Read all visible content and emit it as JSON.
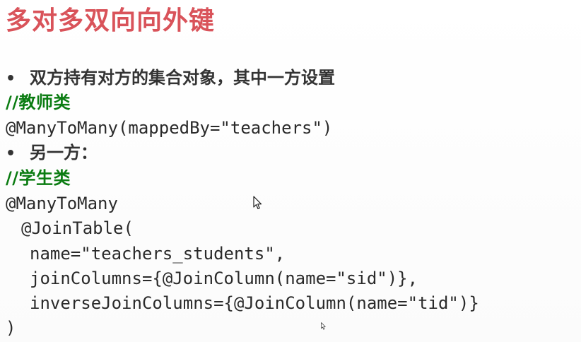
{
  "slide": {
    "title": "多对多双向向外键",
    "bullet1": "双方持有对方的集合对象，其中一方设置",
    "teacher_comment": "//教师类",
    "teacher_annotation": "@ManyToMany(mappedBy=\"teachers\")",
    "bullet2": "另一方：",
    "student_comment": "//学生类",
    "student_annotation": "@ManyToMany",
    "code_lines": [
      " @JoinTable(",
      "name=\"teachers_students\",",
      "joinColumns={@JoinColumn(name=\"sid\")},",
      "inverseJoinColumns={@JoinColumn(name=\"tid\")}",
      ")"
    ]
  },
  "icons": {
    "bullet": "bullet-dot",
    "pointer": "mouse-pointer-icon"
  },
  "colors": {
    "title": "#d9535a",
    "comment": "#0b7c12",
    "text": "#333333",
    "code": "#2a2a2a",
    "background": "#ffffff"
  }
}
